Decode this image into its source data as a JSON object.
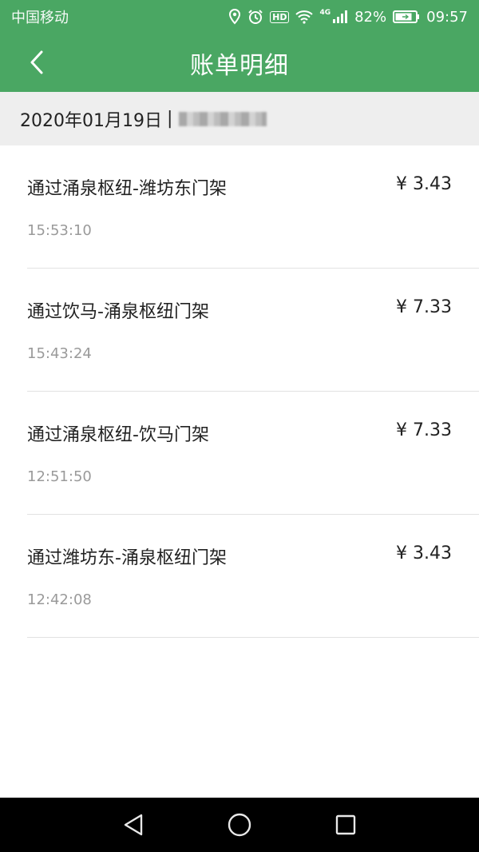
{
  "status_bar": {
    "carrier": "中国移动",
    "hd_badge": "HD",
    "network": "4G",
    "battery": "82%",
    "time": "09:57",
    "icons": [
      "location-icon",
      "alarm-icon",
      "wifi-icon",
      "signal-icon",
      "battery-icon"
    ]
  },
  "header": {
    "title": "账单明细",
    "back_icon": "chevron-left-icon"
  },
  "date_bar": {
    "date": "2020年01月19日",
    "separator": "|"
  },
  "bills": [
    {
      "title": "通过涌泉枢纽-潍坊东门架",
      "amount": "¥ 3.43",
      "time": "15:53:10"
    },
    {
      "title": "通过饮马-涌泉枢纽门架",
      "amount": "¥ 7.33",
      "time": "15:43:24"
    },
    {
      "title": "通过涌泉枢纽-饮马门架",
      "amount": "¥ 7.33",
      "time": "12:51:50"
    },
    {
      "title": "通过潍坊东-涌泉枢纽门架",
      "amount": "¥ 3.43",
      "time": "12:42:08"
    }
  ],
  "nav_bar": {
    "buttons": [
      "back-triangle-icon",
      "home-circle-icon",
      "recents-square-icon"
    ]
  },
  "colors": {
    "brand_green": "#4aa763",
    "date_bar_bg": "#eeeeee",
    "text_primary": "#222222",
    "text_secondary": "#9a9a9a"
  }
}
